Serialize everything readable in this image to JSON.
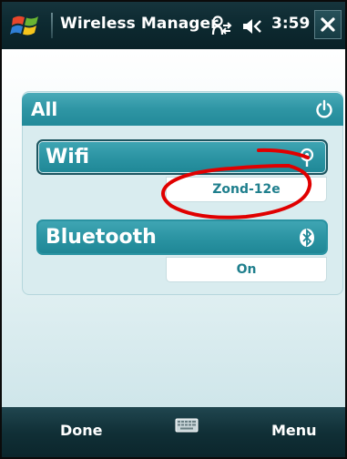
{
  "window": {
    "title": "Wireless Manager",
    "clock": "3:59"
  },
  "icons": {
    "start": "windows-start-icon",
    "connectivity": "connectivity-icon",
    "volume": "volume-icon",
    "close": "close-icon",
    "power": "power-icon",
    "wifi": "wifi-icon",
    "bluetooth": "bluetooth-icon",
    "keyboard": "keyboard-icon"
  },
  "all": {
    "label": "All"
  },
  "radios": [
    {
      "label": "Wifi",
      "status": "Zond-12e"
    },
    {
      "label": "Bluetooth",
      "status": "On"
    }
  ],
  "softkeys": {
    "left": "Done",
    "right": "Menu"
  },
  "colors": {
    "titlebar": "#0d2a31",
    "accent": "#2e95a4",
    "status_text": "#1f7f8d",
    "annotation": "#e00000"
  }
}
